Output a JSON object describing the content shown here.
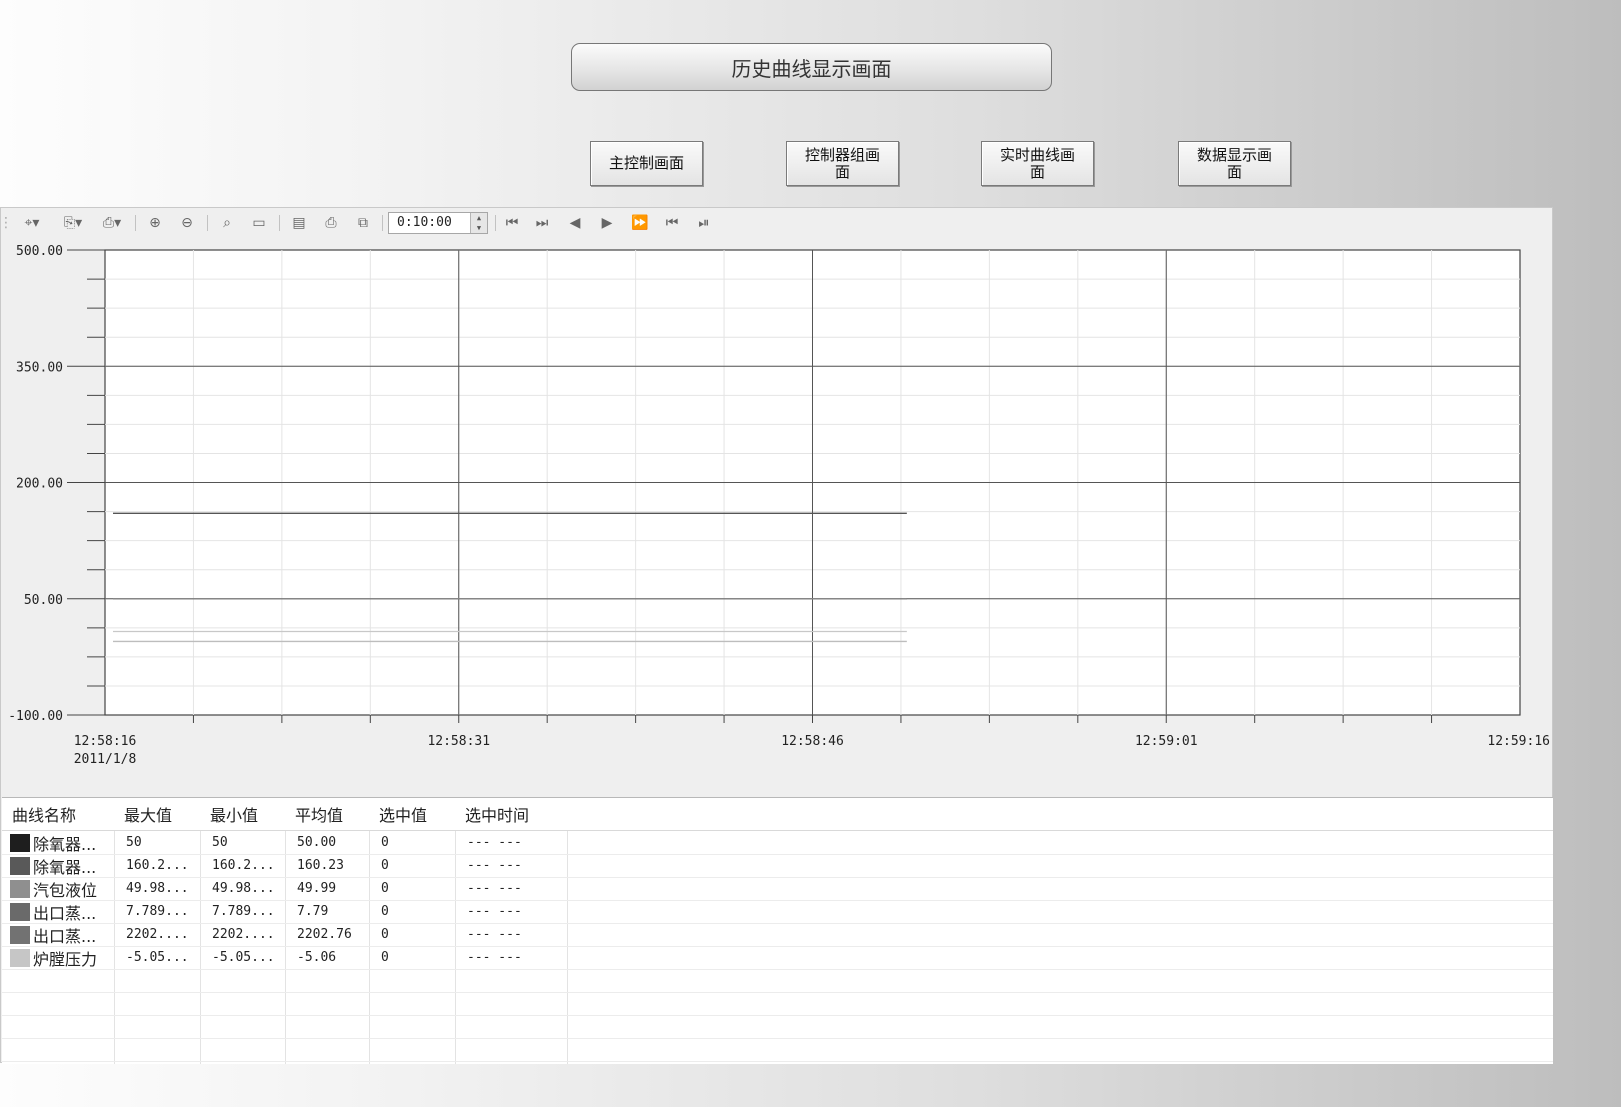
{
  "title": "历史曲线显示画面",
  "nav_buttons": [
    {
      "label": "主控制画面"
    },
    {
      "label": "控制器组画\n面"
    },
    {
      "label": "实时曲线画\n面"
    },
    {
      "label": "数据显示画\n面"
    }
  ],
  "toolbar": {
    "time_span": "0:10:00",
    "icons": [
      "select-tool-icon",
      "export-icon",
      "import-icon",
      "zoom-in-icon",
      "zoom-out-icon",
      "zoom-area-icon",
      "zoom-reset-icon",
      "document-icon",
      "print-icon",
      "copy-icon",
      "first-icon",
      "prev-page-icon",
      "step-back-icon",
      "step-forward-icon",
      "next-page-icon",
      "start-icon",
      "stop-icon"
    ]
  },
  "chart_data": {
    "type": "line",
    "y_ticks": [
      "500.00",
      "350.00",
      "200.00",
      "50.00",
      "-100.00"
    ],
    "ylim": [
      -100,
      500
    ],
    "x_ticks": [
      "12:58:16",
      "12:58:31",
      "12:58:46",
      "12:59:01",
      "12:59:16"
    ],
    "x_date": "2011/1/8",
    "xlim": [
      "12:58:16",
      "12:59:16"
    ],
    "grid": true,
    "series": [
      {
        "values_x": [
          "12:58:16",
          "12:58:50"
        ],
        "values_y": [
          160.23,
          160.23
        ],
        "color": "#555555"
      },
      {
        "values_x": [
          "12:58:16",
          "12:58:50"
        ],
        "values_y": [
          50,
          50
        ],
        "color": "#555555"
      },
      {
        "values_x": [
          "12:58:16",
          "12:58:50"
        ],
        "values_y": [
          49.99,
          49.99
        ],
        "color": "#8a8a8a"
      },
      {
        "values_x": [
          "12:58:16",
          "12:58:50"
        ],
        "values_y": [
          -5.06,
          -5.06
        ],
        "color": "#bdbdbd"
      },
      {
        "values_x": [
          "12:58:16",
          "12:58:50"
        ],
        "values_y": [
          7.79,
          7.79
        ],
        "color": "#c8c8c8"
      }
    ]
  },
  "table": {
    "headers": [
      "曲线名称",
      "最大值",
      "最小值",
      "平均值",
      "选中值",
      "选中时间"
    ],
    "rows": [
      {
        "name": "除氧器...",
        "max": "50",
        "min": "50",
        "avg": "50.00",
        "sel": "0",
        "time": "--- ---",
        "color": "#1e1e1e"
      },
      {
        "name": "除氧器...",
        "max": "160.2...",
        "min": "160.2...",
        "avg": "160.23",
        "sel": "0",
        "time": "--- ---",
        "color": "#595959"
      },
      {
        "name": "汽包液位",
        "max": "49.98...",
        "min": "49.98...",
        "avg": "49.99",
        "sel": "0",
        "time": "--- ---",
        "color": "#8f8f8f"
      },
      {
        "name": "出口蒸...",
        "max": "7.789...",
        "min": "7.789...",
        "avg": "7.79",
        "sel": "0",
        "time": "--- ---",
        "color": "#6a6a6a"
      },
      {
        "name": "出口蒸...",
        "max": "2202....",
        "min": "2202....",
        "avg": "2202.76",
        "sel": "0",
        "time": "--- ---",
        "color": "#727272"
      },
      {
        "name": "炉膛压力",
        "max": "-5.05...",
        "min": "-5.05...",
        "avg": "-5.06",
        "sel": "0",
        "time": "--- ---",
        "color": "#c6c6c6"
      }
    ]
  }
}
